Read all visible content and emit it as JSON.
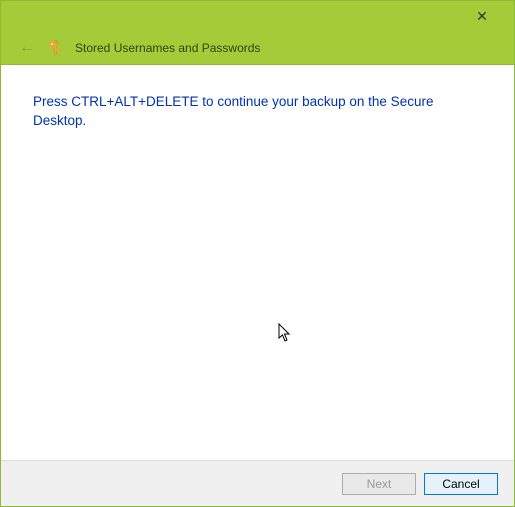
{
  "titlebar": {
    "close_symbol": "✕"
  },
  "header": {
    "back_symbol": "←",
    "title": "Stored Usernames and Passwords"
  },
  "content": {
    "message": "Press CTRL+ALT+DELETE to continue your backup on the Secure Desktop."
  },
  "footer": {
    "next_label": "Next",
    "cancel_label": "Cancel"
  }
}
